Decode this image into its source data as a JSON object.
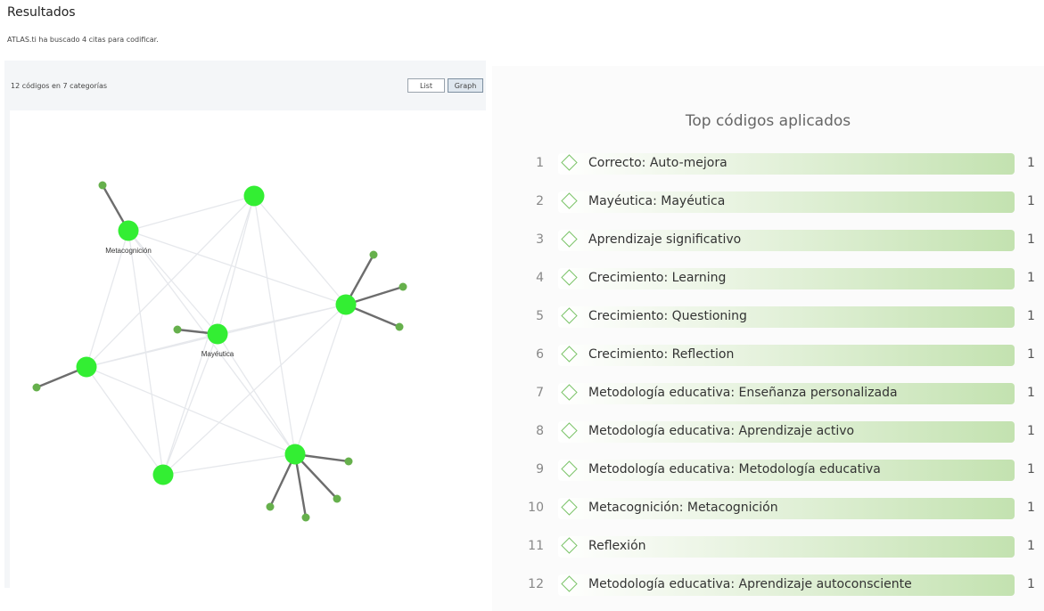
{
  "header": {
    "title": "Resultados",
    "subtitle": "ATLAS.ti ha buscado 4 citas para codificar."
  },
  "left_panel": {
    "summary": "12 códigos en 7 categorías",
    "buttons": {
      "list": "List",
      "graph": "Graph"
    },
    "graph": {
      "node_color": "#33ee33",
      "leaf_color": "#66b04c",
      "labels": {
        "metacognicion": "Metacognición",
        "mayeutica": "Mayéutica"
      }
    }
  },
  "right_panel": {
    "title": "Top códigos aplicados",
    "accent": "#7cc46a",
    "items": [
      {
        "rank": "1",
        "label": "Correcto: Auto-mejora",
        "count": "1"
      },
      {
        "rank": "2",
        "label": "Mayéutica: Mayéutica",
        "count": "1"
      },
      {
        "rank": "3",
        "label": "Aprendizaje significativo",
        "count": "1"
      },
      {
        "rank": "4",
        "label": "Crecimiento: Learning",
        "count": "1"
      },
      {
        "rank": "5",
        "label": "Crecimiento: Questioning",
        "count": "1"
      },
      {
        "rank": "6",
        "label": "Crecimiento: Reflection",
        "count": "1"
      },
      {
        "rank": "7",
        "label": "Metodología educativa: Enseñanza personalizada",
        "count": "1"
      },
      {
        "rank": "8",
        "label": "Metodología educativa: Aprendizaje activo",
        "count": "1"
      },
      {
        "rank": "9",
        "label": "Metodología educativa: Metodología educativa",
        "count": "1"
      },
      {
        "rank": "10",
        "label": "Metacognición: Metacognición",
        "count": "1"
      },
      {
        "rank": "11",
        "label": "Reflexión",
        "count": "1"
      },
      {
        "rank": "12",
        "label": "Metodología educativa: Aprendizaje autoconsciente",
        "count": "1"
      }
    ]
  }
}
